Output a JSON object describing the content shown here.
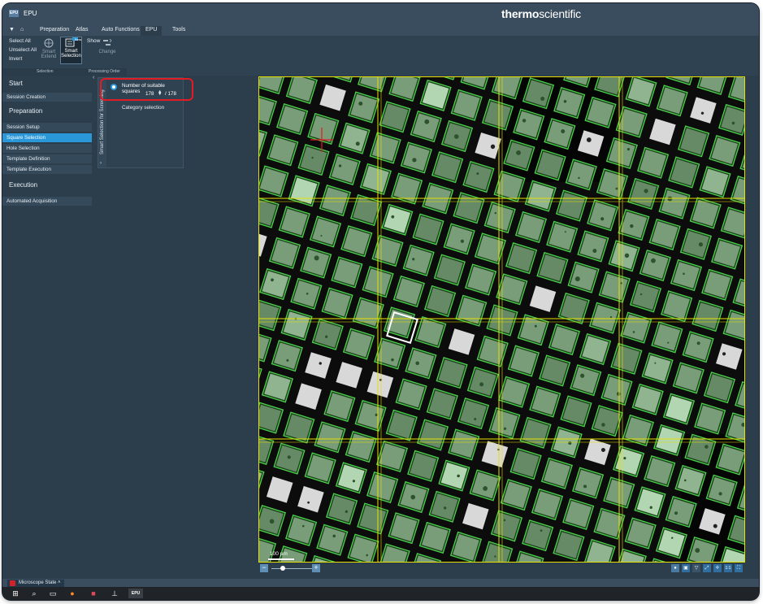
{
  "window": {
    "app_logo": "EPU",
    "app_title": "EPU",
    "brand_bold": "thermo",
    "brand_light": "scientific"
  },
  "menu": {
    "items": [
      "Preparation",
      "Atlas",
      "Auto Functions",
      "EPU",
      "Tools"
    ],
    "active": "EPU"
  },
  "ribbon": {
    "select_all": "Select All",
    "unselect_all": "Unselect All",
    "invert": "Invert",
    "smart_extend": "Smart Extend",
    "smart_selection": "Smart Selection",
    "beta_badge": "Beta",
    "show": "Show",
    "change": "Change",
    "group_selection": "Selection",
    "group_processing_order": "Processing Order"
  },
  "sidebar": {
    "sections": [
      {
        "title": "Start",
        "items": [
          "Session Creation"
        ]
      },
      {
        "title": "Preparation",
        "items": [
          "Session Setup",
          "Square Selection",
          "Hole Selection",
          "Template Definition",
          "Template Execution"
        ]
      },
      {
        "title": "Execution",
        "items": [
          "Automated Acquisition"
        ]
      }
    ],
    "selected": "Square Selection",
    "collapse_icon": "chevron-left"
  },
  "smart_panel": {
    "tab_label": "Smart Selection for Screening",
    "option_count_label": "Number of suitable squares",
    "count_value": "178",
    "count_total": "/ 178",
    "option_category_label": "Category selection",
    "highlight_color": "#e31b23"
  },
  "atlas": {
    "scale_label": "100 µm",
    "selection_color": "#4cd14c",
    "grid_line_color": "#e8e000",
    "cursor_color": "#e31b23"
  },
  "zoom": {
    "minus": "−",
    "plus": "+",
    "one_to_one": "1:1"
  },
  "status": {
    "microscope_state": "Microscope State"
  },
  "taskbar": {
    "epu_label": "EPU"
  },
  "colors": {
    "accent": "#2a98d8",
    "panel_bg": "#2c3d4c"
  }
}
